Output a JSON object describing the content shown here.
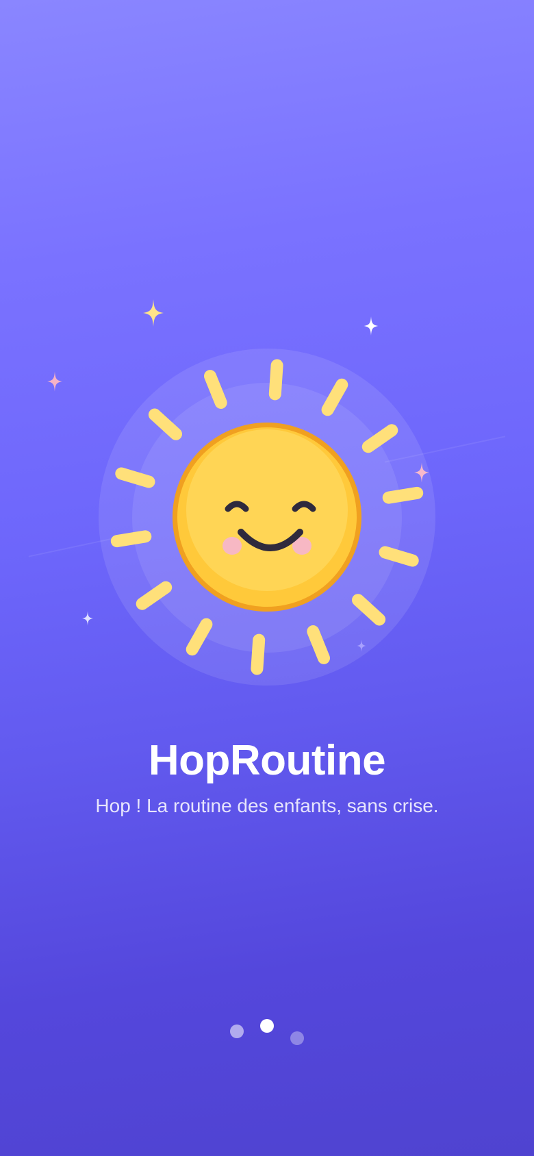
{
  "app": {
    "title": "HopRoutine",
    "tagline": "Hop ! La routine des enfants, sans crise."
  },
  "illustration": {
    "icon": "smiling-sun-icon",
    "sun_color": "#ffd24d",
    "sun_outline_color": "#f0a020",
    "ray_color": "#ffe07a",
    "face_color": "#2f2a3d",
    "cheek_color": "#f7b8c4"
  },
  "sparkles": [
    "sparkle-icon"
  ],
  "loader": {
    "dots": 3,
    "active_index": 1
  },
  "colors": {
    "background_top": "#8a86ff",
    "background_bottom": "#4f43d0",
    "text": "#ffffff"
  }
}
